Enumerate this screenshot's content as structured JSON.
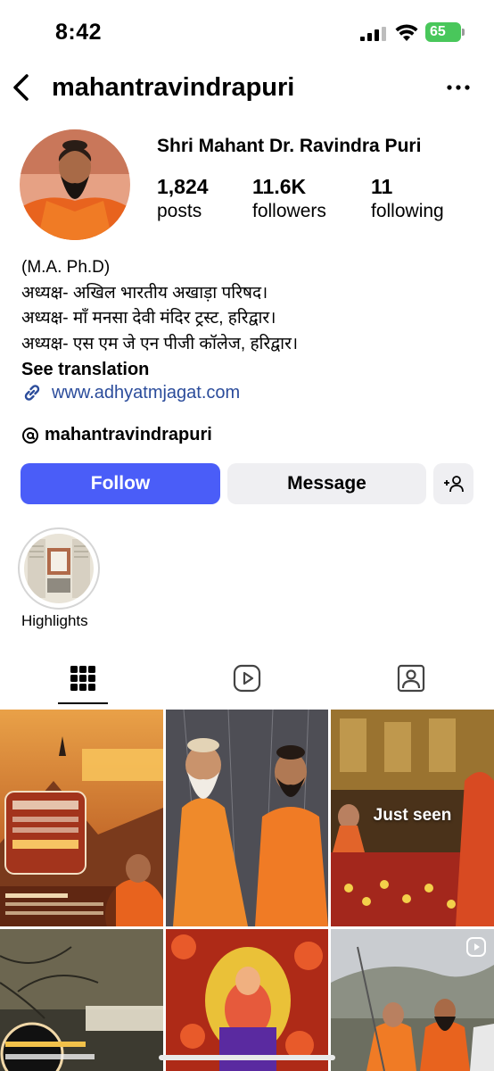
{
  "status_bar": {
    "time": "8:42",
    "battery": "65"
  },
  "header": {
    "username": "mahantravindrapuri"
  },
  "profile": {
    "full_name": "Shri Mahant Dr. Ravindra Puri",
    "stats": [
      {
        "value": "1,824",
        "label": "posts"
      },
      {
        "value": "11.6K",
        "label": "followers"
      },
      {
        "value": "11",
        "label": "following"
      }
    ],
    "bio_lines": [
      "(M.A. Ph.D)",
      "अध्यक्ष- अखिल भारतीय अखाड़ा परिषद।",
      "अध्यक्ष- माँ मनसा देवी मंदिर ट्रस्ट, हरिद्वार।",
      "अध्यक्ष- एस एम जे एन पीजी कॉलेज, हरिद्वार।"
    ],
    "see_translation": "See translation",
    "website": "www.adhyatmjagat.com",
    "threads_handle": "mahantravindrapuri"
  },
  "actions": {
    "follow": "Follow",
    "message": "Message"
  },
  "highlights": [
    {
      "label": "Highlights"
    }
  ],
  "tabs": [
    "grid-icon",
    "reels-icon",
    "tagged-icon"
  ],
  "grid": {
    "posts": [
      {
        "id": 1,
        "overlay_text": ""
      },
      {
        "id": 2,
        "overlay_text": ""
      },
      {
        "id": 3,
        "overlay_text": "Just seen"
      },
      {
        "id": 4,
        "overlay_text": ""
      },
      {
        "id": 5,
        "overlay_text": ""
      },
      {
        "id": 6,
        "overlay_text": ""
      }
    ]
  },
  "colors": {
    "follow": "#4a5df8",
    "link": "#2b4c9b",
    "battery": "#49c75b",
    "secondary_btn": "#efeff2"
  }
}
